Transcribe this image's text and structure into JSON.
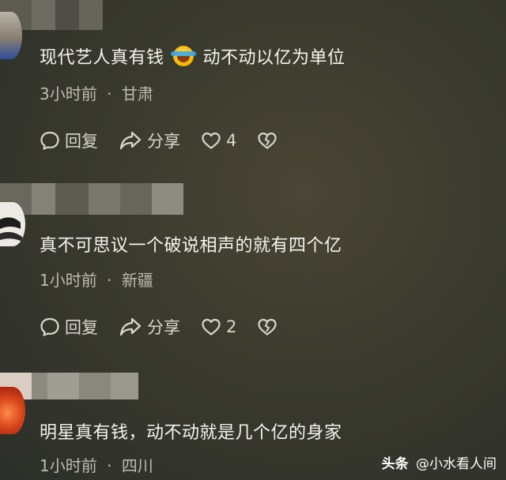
{
  "comments": [
    {
      "text_before": "现代艺人真有钱",
      "emoji": "laughing-tears-emoji",
      "text_after": "动不动以亿为单位",
      "time": "3小时前",
      "separator": "·",
      "location": "甘肃",
      "reply_label": "回复",
      "share_label": "分享",
      "like_count": "4"
    },
    {
      "text": "真不可思议一个破说相声的就有四个亿",
      "time": "1小时前",
      "separator": "·",
      "location": "新疆",
      "reply_label": "回复",
      "share_label": "分享",
      "like_count": "2"
    },
    {
      "text": "明星真有钱，动不动就是几个亿的身家",
      "time": "1小时前",
      "separator": "·",
      "location": "四川"
    }
  ],
  "watermark": {
    "brand": "头条",
    "separator": "@",
    "author": "小水看人间"
  },
  "colors": {
    "background": "#3a3a2e",
    "text": "#f5f5f0",
    "meta": "#bdbcb4"
  },
  "icons": [
    "comment-bubble-icon",
    "share-arrow-icon",
    "heart-icon",
    "broken-heart-icon"
  ]
}
